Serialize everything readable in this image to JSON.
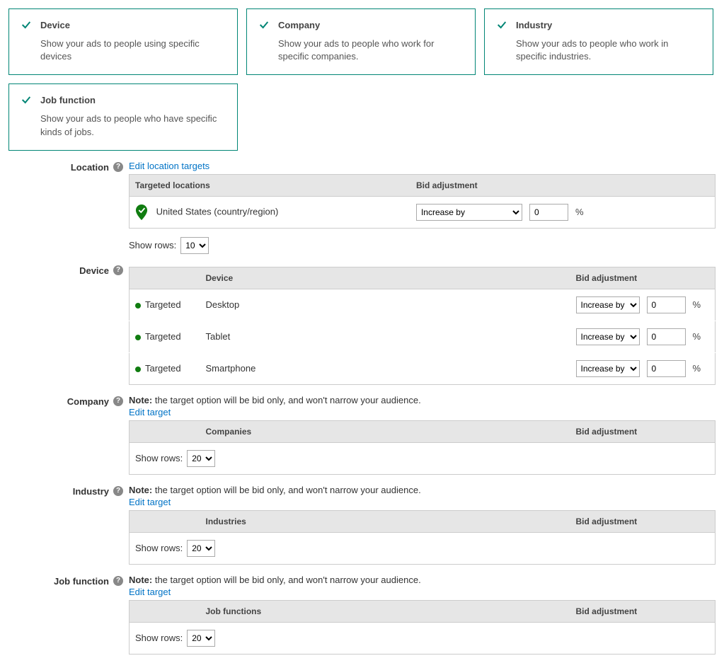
{
  "cards": [
    {
      "title": "Device",
      "desc": "Show your ads to people using specific devices"
    },
    {
      "title": "Company",
      "desc": "Show your ads to people who work for specific companies."
    },
    {
      "title": "Industry",
      "desc": "Show your ads to people who work in specific industries."
    },
    {
      "title": "Job function",
      "desc": "Show your ads to people who have specific kinds of jobs."
    }
  ],
  "labels": {
    "location": "Location",
    "device": "Device",
    "company": "Company",
    "industry": "Industry",
    "jobfunction": "Job function",
    "edit_location": "Edit location targets",
    "edit_target": "Edit target",
    "show_rows": "Show rows:",
    "targeted": "Targeted",
    "percent": "%",
    "note_prefix": "Note:",
    "note_text": " the target option will be bid only, and won't narrow your audience."
  },
  "headers": {
    "targeted_locations": "Targeted locations",
    "bid_adjustment": "Bid adjustment",
    "device": "Device",
    "companies": "Companies",
    "industries": "Industries",
    "job_functions": "Job functions"
  },
  "location": {
    "row": {
      "name": "United States (country/region)",
      "bid_op": "Increase by",
      "bid_val": "0"
    },
    "show_rows": "10"
  },
  "device": {
    "rows": [
      {
        "name": "Desktop",
        "bid_op": "Increase by",
        "bid_val": "0"
      },
      {
        "name": "Tablet",
        "bid_op": "Increase by",
        "bid_val": "0"
      },
      {
        "name": "Smartphone",
        "bid_op": "Increase by",
        "bid_val": "0"
      }
    ]
  },
  "company": {
    "show_rows": "20"
  },
  "industry": {
    "show_rows": "20"
  },
  "jobfunction": {
    "show_rows": "20"
  }
}
